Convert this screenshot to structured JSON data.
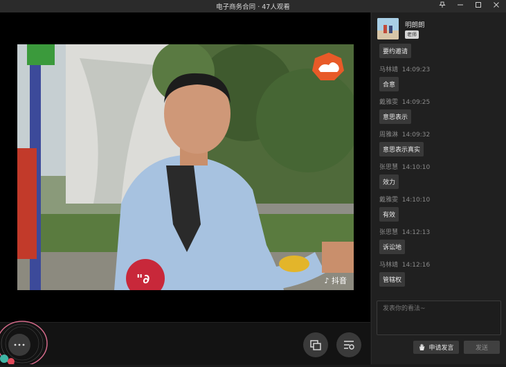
{
  "window": {
    "title": "电子商务合同 · 47人观看",
    "pin_icon": "pin-icon",
    "minimize_icon": "minimize-icon",
    "maximize_icon": "maximize-icon",
    "close_icon": "close-icon"
  },
  "video": {
    "watermark_text": "抖音"
  },
  "controls": {
    "more_icon": "more-icon",
    "layout_icon": "layout-icon",
    "settings_icon": "list-settings-icon"
  },
  "teacher": {
    "name": "明朗朗",
    "role": "老师"
  },
  "chat": {
    "partial_top": "要约邀请",
    "messages": [
      {
        "user": "马林靖",
        "time": "14:09:23",
        "text": "合意"
      },
      {
        "user": "戴雅雯",
        "time": "14:09:25",
        "text": "意思表示"
      },
      {
        "user": "周雅淋",
        "time": "14:09:32",
        "text": "意思表示真实"
      },
      {
        "user": "张思慧",
        "time": "14:10:10",
        "text": "效力"
      },
      {
        "user": "戴雅雯",
        "time": "14:10:10",
        "text": "有效"
      },
      {
        "user": "张思慧",
        "time": "14:12:13",
        "text": "诉讼地"
      },
      {
        "user": "马林靖",
        "time": "14:12:16",
        "text": "管辖权"
      }
    ]
  },
  "composer": {
    "placeholder": "发表你的看法~",
    "apply_label": "申请发言",
    "send_label": "发送"
  }
}
